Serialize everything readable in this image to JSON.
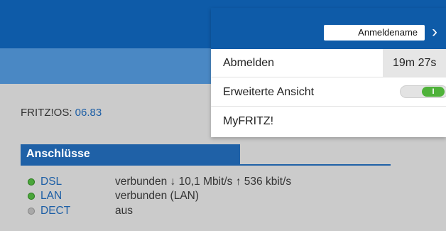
{
  "header": {
    "login_box": "Anmeldename",
    "chevron": "›"
  },
  "menu": {
    "logout_label": "Abmelden",
    "session_time": "19m 27s",
    "advanced_view_label": "Erweiterte Ansicht",
    "advanced_view_toggle": "I",
    "advanced_view_on": true,
    "myfritz_label": "MyFRITZ!"
  },
  "info": {
    "fritzos_label": "FRITZ!OS: ",
    "fritzos_version": "06.83"
  },
  "connections": {
    "title": "Anschlüsse",
    "items": [
      {
        "name": "DSL",
        "status": "verbunden ↓ 10,1 Mbit/s ↑ 536 kbit/s",
        "state_color": "#4aa63a"
      },
      {
        "name": "LAN",
        "status": "verbunden (LAN)",
        "state_color": "#4aa63a"
      },
      {
        "name": "DECT",
        "status": "aus",
        "state_color": "#a9a9a9"
      }
    ]
  }
}
